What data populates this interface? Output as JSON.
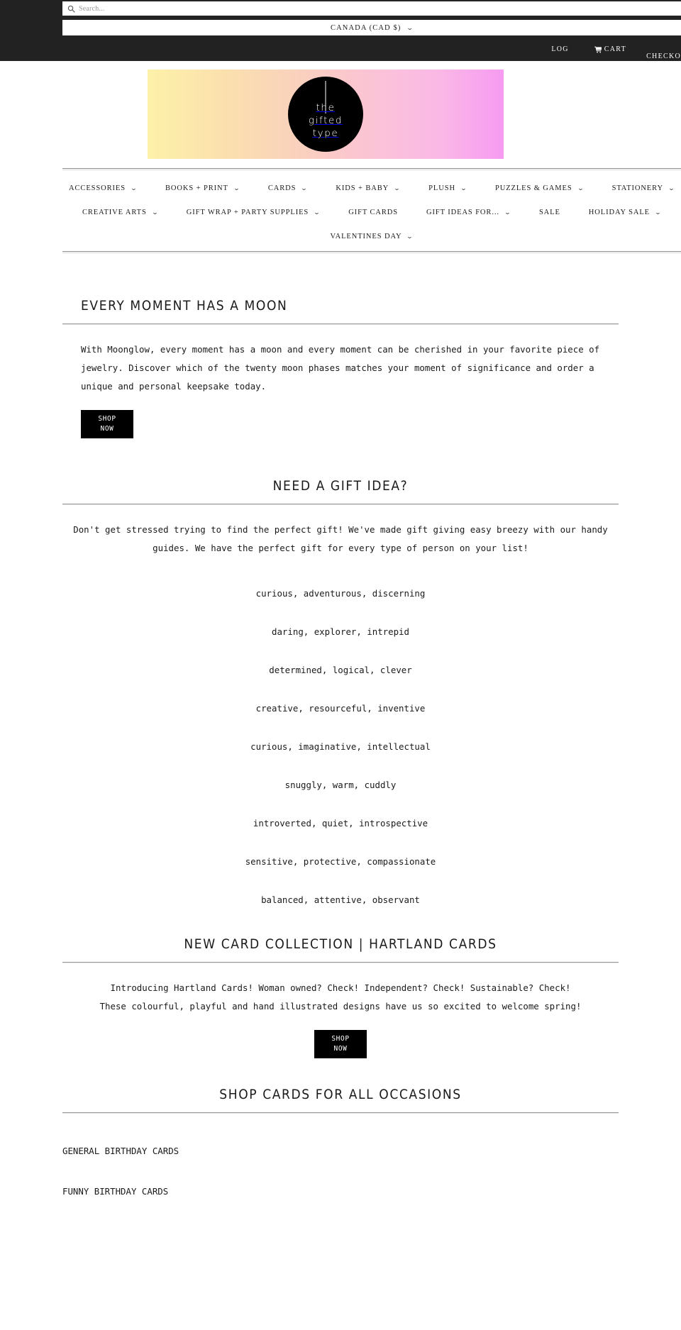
{
  "topbar": {
    "search": {
      "icon": "search-icon",
      "placeholder": "Search...",
      "value": ""
    },
    "currency": {
      "label": "CANADA (CAD $)",
      "caret": "⌄"
    },
    "utilities": {
      "login_label": "LOG",
      "cart_label": "CART",
      "cart_icon": "shopping-cart-icon",
      "checkout_label": "CHECKO"
    }
  },
  "logo": {
    "line1": "the",
    "line2": "gifted",
    "line3": "type",
    "gradient_start": "#fdf1a8",
    "gradient_mid": "#fbc9c8",
    "gradient_end": "#f79bf2",
    "circle_color": "#000000"
  },
  "nav": {
    "caret": "⌄",
    "rows": [
      [
        {
          "label": "ACCESSORIES",
          "has_dropdown": true
        },
        {
          "label": "BOOKS + PRINT",
          "has_dropdown": true
        },
        {
          "label": "CARDS",
          "has_dropdown": true
        },
        {
          "label": "KIDS + BABY",
          "has_dropdown": true
        },
        {
          "label": "PLUSH",
          "has_dropdown": true
        },
        {
          "label": "PUZZLES & GAMES",
          "has_dropdown": true
        },
        {
          "label": "STATIONERY",
          "has_dropdown": true
        }
      ],
      [
        {
          "label": "CREATIVE ARTS",
          "has_dropdown": true
        },
        {
          "label": "GIFT WRAP + PARTY SUPPLIES",
          "has_dropdown": true
        },
        {
          "label": "GIFT CARDS",
          "has_dropdown": false
        },
        {
          "label": "GIFT IDEAS FOR...",
          "has_dropdown": true
        },
        {
          "label": "SALE",
          "has_dropdown": false
        },
        {
          "label": "HOLIDAY SALE",
          "has_dropdown": true
        }
      ],
      [
        {
          "label": "VALENTINES DAY",
          "has_dropdown": true
        }
      ]
    ]
  },
  "moon_section": {
    "title": "EVERY MOMENT HAS A MOON",
    "body": "With Moonglow, every moment has a moon and every moment can be cherished in your favorite piece of jewelry. Discover which of the twenty moon phases matches your moment of significance and order a unique and personal keepsake today.",
    "button_line1": "SHOP",
    "button_line2": "NOW"
  },
  "gift_idea_section": {
    "title": "NEED A GIFT IDEA?",
    "body": "Don't get stressed trying to find the perfect gift! We've made gift giving easy breezy with our handy guides. We have the perfect gift for every type of person on your list!",
    "traits": [
      "curious, adventurous, discerning",
      "daring, explorer, intrepid",
      "determined, logical, clever",
      "creative, resourceful, inventive",
      "curious, imaginative, intellectual",
      "snuggly, warm, cuddly",
      "introverted, quiet, introspective",
      "sensitive, protective, compassionate",
      "balanced, attentive, observant"
    ]
  },
  "hartland_section": {
    "title": "NEW CARD COLLECTION | HARTLAND CARDS",
    "body_line1": "Introducing Hartland Cards! Woman owned? Check! Independent? Check! Sustainable? Check!",
    "body_line2": "These colourful, playful and hand illustrated designs have us so excited to welcome spring!",
    "button_line1": "SHOP",
    "button_line2": "NOW"
  },
  "occasions_section": {
    "title": "SHOP CARDS FOR ALL OCCASIONS",
    "items": [
      "GENERAL BIRTHDAY CARDS",
      "FUNNY BIRTHDAY CARDS"
    ]
  }
}
